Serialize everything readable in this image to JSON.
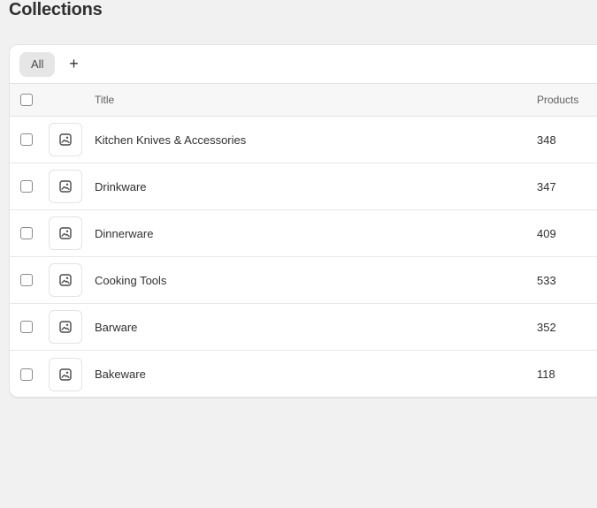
{
  "page": {
    "title": "Collections"
  },
  "tabs": {
    "items": [
      {
        "label": "All",
        "active": true
      }
    ],
    "add_label": "+"
  },
  "table": {
    "columns": {
      "title": "Title",
      "products": "Products"
    },
    "rows": [
      {
        "title": "Kitchen Knives & Accessories",
        "products": "348",
        "image_icon": "image-placeholder-icon"
      },
      {
        "title": "Drinkware",
        "products": "347",
        "image_icon": "image-placeholder-icon"
      },
      {
        "title": "Dinnerware",
        "products": "409",
        "image_icon": "image-placeholder-icon"
      },
      {
        "title": "Cooking Tools",
        "products": "533",
        "image_icon": "image-placeholder-icon"
      },
      {
        "title": "Barware",
        "products": "352",
        "image_icon": "image-placeholder-icon"
      },
      {
        "title": "Bakeware",
        "products": "118",
        "image_icon": "image-placeholder-icon"
      }
    ]
  },
  "colors": {
    "background": "#f1f1f1",
    "card": "#ffffff",
    "active_tab": "#e6e6e6",
    "text": "#303030"
  }
}
